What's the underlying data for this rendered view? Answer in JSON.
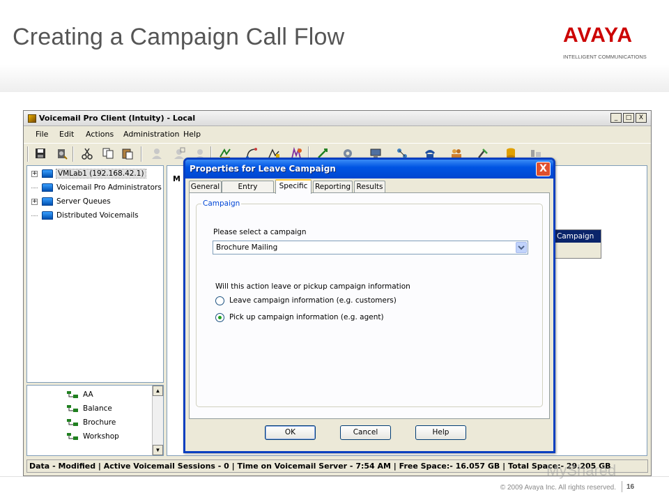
{
  "slide": {
    "title": "Creating a Campaign Call Flow",
    "logo_text": "AVAYA",
    "logo_sub": "INTELLIGENT COMMUNICATIONS",
    "copyright": "© 2009 Avaya Inc. All rights reserved.",
    "page_number": "16",
    "watermark": "MyShared"
  },
  "app": {
    "title": "Voicemail Pro Client (Intuity) - Local",
    "window_buttons": [
      "_",
      "□",
      "X"
    ],
    "menu": [
      "File",
      "Edit",
      "Actions",
      "Administration",
      "Help"
    ],
    "toolbar_icons": [
      "save-icon",
      "server-icon",
      "cut-icon",
      "copy-icon",
      "paste-icon",
      "user-icon",
      "user-admin-icon",
      "user-tools-icon",
      "start-action-icon",
      "route-icon",
      "mailbox-icon",
      "campaign-icon",
      "connector-icon",
      "settings-icon",
      "computer-icon",
      "network-icon",
      "telephony-icon",
      "people-icon",
      "tools-icon",
      "database-icon",
      "condition-icon"
    ],
    "tree": [
      {
        "label": "VMLab1 (192.168.42.1)",
        "expandable": true,
        "selected": true
      },
      {
        "label": "Voicemail Pro Administrators",
        "expandable": false,
        "selected": false
      },
      {
        "label": "Server Queues",
        "expandable": true,
        "selected": false
      },
      {
        "label": "Distributed Voicemails",
        "expandable": false,
        "selected": false
      }
    ],
    "call_flows": [
      "AA",
      "Balance",
      "Brochure",
      "Workshop"
    ],
    "main_label": "M",
    "action_box_label": "Campaign",
    "status_bar": "Data - Modified  |  Active Voicemail Sessions - 0  |  Time on Voicemail Server - 7:54 AM  |  Free Space:- 16.057 GB  |  Total Space:- 29.205 GB"
  },
  "dialog": {
    "title": "Properties for Leave Campaign",
    "close_label": "X",
    "tabs": [
      "General",
      "Entry Prompts",
      "Specific",
      "Reporting",
      "Results"
    ],
    "active_tab": "Specific",
    "group_label": "Campaign",
    "select_label": "Please select a campaign",
    "select_value": "Brochure Mailing",
    "question": "Will this action leave or pickup campaign information",
    "options": [
      {
        "label": "Leave campaign information (e.g. customers)",
        "checked": false
      },
      {
        "label": "Pick up campaign information (e.g. agent)",
        "checked": true
      }
    ],
    "buttons": {
      "ok": "OK",
      "cancel": "Cancel",
      "help": "Help"
    }
  }
}
